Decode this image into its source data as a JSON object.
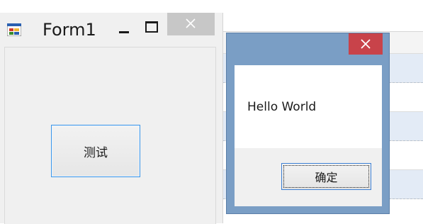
{
  "form_window": {
    "title": "Form1",
    "icon": "app-form-icon",
    "controls": {
      "minimize_icon": "minimize-icon",
      "maximize_icon": "maximize-icon",
      "close_icon": "close-icon"
    },
    "test_button_label": "测试"
  },
  "message_box": {
    "message": "Hello World",
    "ok_label": "确定",
    "close_icon": "close-icon",
    "colors": {
      "frame": "#7a9ec5",
      "close_button": "#c8434a"
    }
  },
  "colors": {
    "focus_border": "#3c96e8",
    "grid_alt_row": "#e3ebf6"
  }
}
